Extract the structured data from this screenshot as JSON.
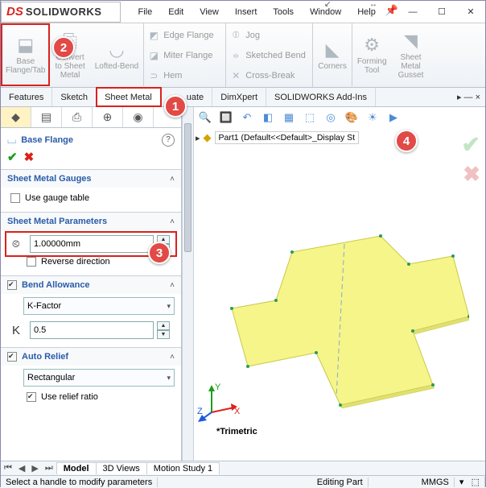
{
  "app": {
    "brand_prefix": "DS",
    "brand_name": "SOLIDWORKS"
  },
  "menu": {
    "file": "File",
    "edit": "Edit",
    "view": "View",
    "insert": "Insert",
    "tools": "Tools",
    "window": "Window",
    "help": "Help"
  },
  "ribbon": {
    "base_flange": "Base\nFlange/Tab",
    "convert": "Convert\nto Sheet\nMetal",
    "lofted": "Lofted-Bend",
    "edge_flange": "Edge Flange",
    "miter_flange": "Miter Flange",
    "hem": "Hem",
    "jog": "Jog",
    "sketched_bend": "Sketched Bend",
    "cross_break": "Cross-Break",
    "corners": "Corners",
    "forming": "Forming\nTool",
    "gusset": "Sheet\nMetal\nGusset"
  },
  "tabs": {
    "features": "Features",
    "sketch": "Sketch",
    "sheet_metal": "Sheet Metal",
    "evaluate_suffix": "uate",
    "dimxpert": "DimXpert",
    "addins": "SOLIDWORKS Add-Ins"
  },
  "pm": {
    "title": "Base Flange",
    "gauges_title": "Sheet Metal Gauges",
    "use_gauge": "Use gauge table",
    "params_title": "Sheet Metal Parameters",
    "thickness": "1.00000mm",
    "reverse": "Reverse direction",
    "bend_title": "Bend Allowance",
    "bend_type": "K-Factor",
    "kvalue": "0.5",
    "relief_title": "Auto Relief",
    "relief_type": "Rectangular",
    "relief_ratio": "Use relief ratio"
  },
  "viewport": {
    "breadcrumb": "Part1  (Default<<Default>_Display St",
    "view_label": "*Trimetric"
  },
  "bottom": {
    "model": "Model",
    "views3d": "3D Views",
    "motion": "Motion Study 1"
  },
  "status": {
    "msg": "Select a handle to modify parameters",
    "mode": "Editing Part",
    "units": "MMGS"
  },
  "callouts": {
    "c1": "1",
    "c2": "2",
    "c3": "3",
    "c4": "4"
  }
}
